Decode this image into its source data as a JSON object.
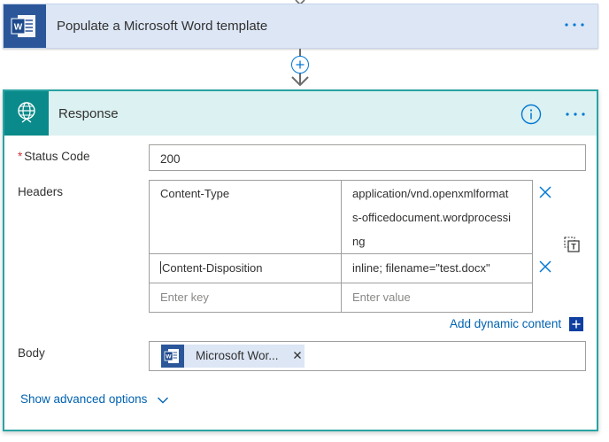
{
  "word_card": {
    "title": "Populate a Microsoft Word template",
    "icon": "word-icon",
    "menu_icon": "more-dots-icon"
  },
  "connector": {
    "add_icon": "plus-circle-icon",
    "arrow_icon": "arrow-down-icon"
  },
  "response_card": {
    "title": "Response",
    "icon": "globe-icon",
    "info_icon": "info-icon",
    "menu_icon": "more-dots-icon",
    "status_code": {
      "required_mark": "*",
      "label": "Status Code",
      "value": "200"
    },
    "headers": {
      "label": "Headers",
      "rows": [
        {
          "key": "Content-Type",
          "value_lines": [
            "application/vnd.openxmlformat",
            "s-officedocument.wordprocessi",
            "ng"
          ]
        },
        {
          "key": "Content-Disposition",
          "value_lines": [
            "inline; filename=\"test.docx\""
          ]
        }
      ],
      "key_placeholder": "Enter key",
      "value_placeholder": "Enter value",
      "delete_icon": "close-icon",
      "switch_mode_icon": "switch-to-text-mode-icon"
    },
    "dynamic_content": {
      "label": "Add dynamic content",
      "icon": "plus-square-icon"
    },
    "body": {
      "label": "Body",
      "token_label": "Microsoft Wor...",
      "token_icon": "word-icon",
      "token_remove": "×"
    },
    "advanced": {
      "label": "Show advanced options",
      "icon": "chevron-down-icon"
    }
  },
  "colors": {
    "word_blue": "#2b579a",
    "word_header_bg": "#dce6f5",
    "response_teal": "#0a8a8a",
    "response_header_bg": "#dcf1f1",
    "response_border": "#2aa3a3",
    "link_blue": "#0062b1",
    "required_red": "#d13438"
  }
}
